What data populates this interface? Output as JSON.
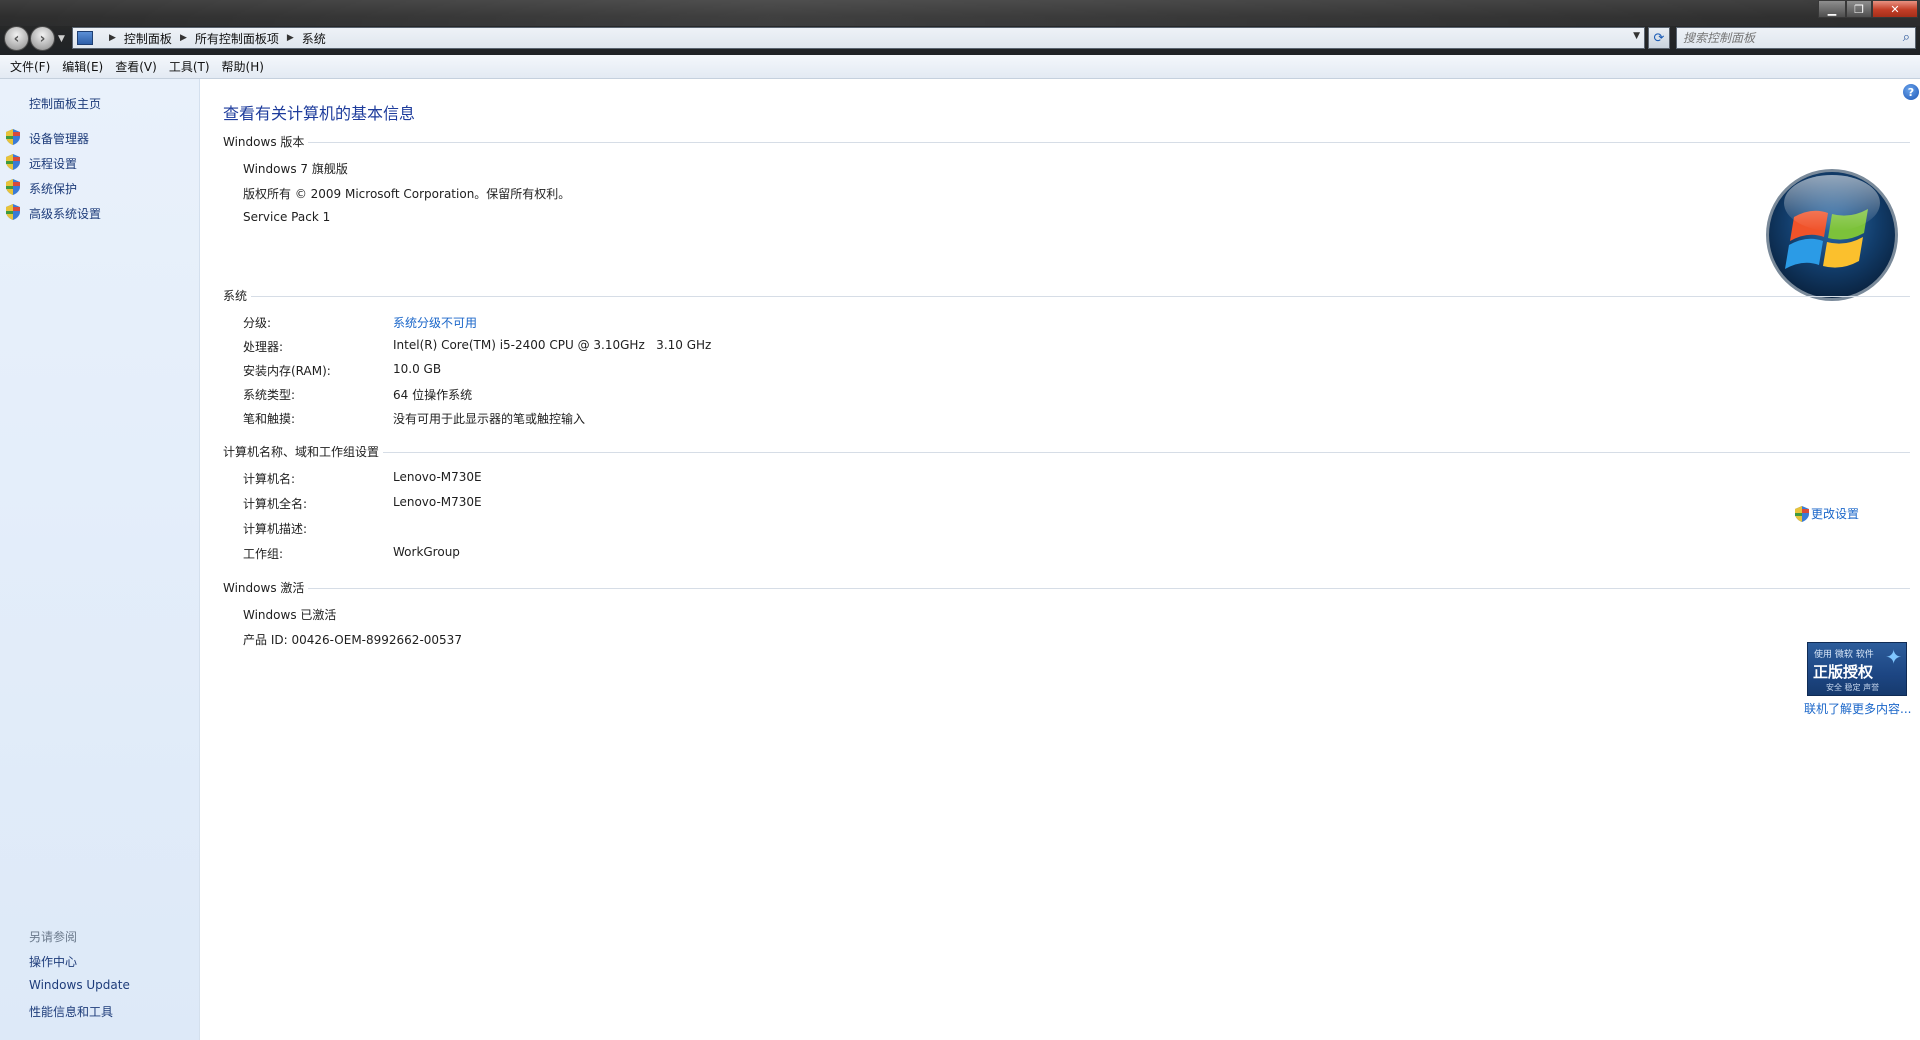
{
  "window": {
    "address": {
      "crumbs": [
        "控制面板",
        "所有控制面板项",
        "系统"
      ]
    },
    "search": {
      "placeholder": "搜索控制面板"
    }
  },
  "menubar": {
    "items": [
      "文件(F)",
      "编辑(E)",
      "查看(V)",
      "工具(T)",
      "帮助(H)"
    ]
  },
  "sidebar": {
    "home": "控制面板主页",
    "tasks": [
      "设备管理器",
      "远程设置",
      "系统保护",
      "高级系统设置"
    ],
    "see_also": {
      "title": "另请参阅",
      "links": [
        "操作中心",
        "Windows Update",
        "性能信息和工具"
      ]
    }
  },
  "main": {
    "title": "查看有关计算机的基本信息",
    "edition": {
      "heading": "Windows 版本",
      "name": "Windows 7 旗舰版",
      "copyright": "版权所有 © 2009 Microsoft Corporation。保留所有权利。",
      "service_pack": "Service Pack 1"
    },
    "system": {
      "heading": "系统",
      "rows": [
        {
          "label": "分级:",
          "value": "系统分级不可用"
        },
        {
          "label": "处理器:",
          "value": "Intel(R) Core(TM) i5-2400 CPU @ 3.10GHz   3.10 GHz"
        },
        {
          "label": "安装内存(RAM):",
          "value": "10.0 GB"
        },
        {
          "label": "系统类型:",
          "value": "64 位操作系统"
        },
        {
          "label": "笔和触摸:",
          "value": "没有可用于此显示器的笔或触控输入"
        }
      ]
    },
    "computer": {
      "heading": "计算机名称、域和工作组设置",
      "change_settings": "更改设置",
      "rows": [
        {
          "label": "计算机名:",
          "value": "Lenovo-M730E"
        },
        {
          "label": "计算机全名:",
          "value": "Lenovo-M730E"
        },
        {
          "label": "计算机描述:",
          "value": ""
        },
        {
          "label": "工作组:",
          "value": "WorkGroup"
        }
      ]
    },
    "activation": {
      "heading": "Windows 激活",
      "status": "Windows 已激活",
      "product_id": "产品 ID: 00426-OEM-8992662-00537",
      "badge": {
        "top": "使用 微软 软件",
        "main": "正版授权",
        "bottom": "安全 稳定 声誉"
      },
      "learn_more": "联机了解更多内容..."
    }
  },
  "colors": {
    "title": "#1e3c9c",
    "link": "#1a66c9",
    "sidebar_bg": "#e9f1fb"
  }
}
